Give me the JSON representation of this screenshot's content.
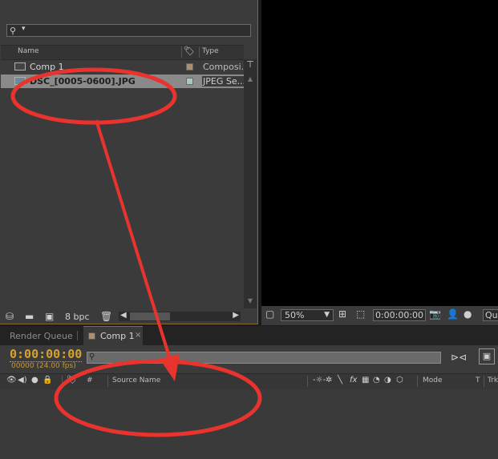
{
  "project": {
    "search_placeholder": "",
    "search_icon": "search-icon",
    "columns": {
      "name": "Name",
      "label_icon": "tag-icon",
      "type": "Type"
    },
    "items": [
      {
        "name": "Comp 1",
        "type": "Composi...",
        "icon": "composition-icon",
        "label_color": "#a89070"
      },
      {
        "name": "DSC_[0005-0600].JPG",
        "type": "JPEG Se...",
        "icon": "image-sequence-icon",
        "label_color": "#a8c8c0"
      }
    ],
    "footer": {
      "bpc": "8 bpc"
    }
  },
  "viewer": {
    "zoom": "50%",
    "timecode": "0:00:00:00",
    "quality_label": "Qu"
  },
  "timeline": {
    "tabs": [
      {
        "label": "Render Queue",
        "active": false
      },
      {
        "label": "Comp 1",
        "active": true,
        "close": "×"
      }
    ],
    "current_time": "0:00:00:00",
    "frame_info": "00000 (24.00 fps)",
    "columns": {
      "number": "#",
      "source_name": "Source Name",
      "mode": "Mode",
      "t": "T",
      "trkmat": "Trk"
    }
  },
  "annotation": {
    "color": "#e8332e"
  }
}
